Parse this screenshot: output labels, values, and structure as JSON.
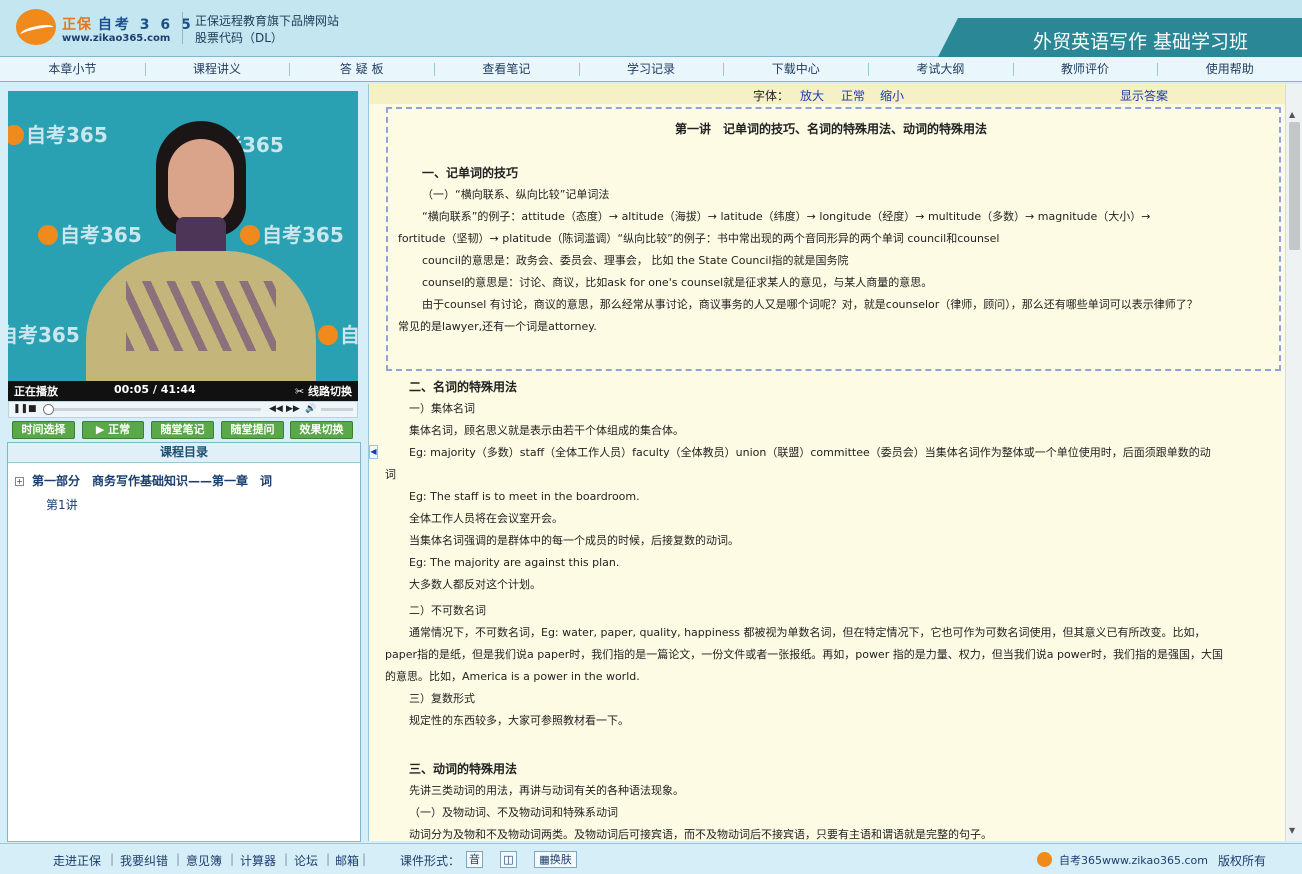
{
  "header": {
    "brand_cn": "正保",
    "brand_kao": "自考 3 6 5",
    "url": "www.zikao365.com",
    "tagline": "正保远程教育旗下品牌网站",
    "stock": "股票代码（DL）",
    "course_title": "外贸英语写作 基础学习班"
  },
  "nav": [
    "本章小节",
    "课程讲义",
    "答 疑 板",
    "查看笔记",
    "学习记录",
    "下载中心",
    "考试大纲",
    "教师评价",
    "使用帮助"
  ],
  "video": {
    "watermark": "自考365",
    "watermark_url": "zikao365.com",
    "status": "正在播放",
    "time": "00:05 / 41:44",
    "switch_line": "线路切换",
    "progress": 0.0
  },
  "buttons": {
    "time_select": "时间选择",
    "normal": "▶ 正常",
    "notes": "随堂笔记",
    "ask": "随堂提问",
    "effect": "效果切换"
  },
  "catalog": {
    "header": "课程目录",
    "part": "第一部分　商务写作基础知识——第一章　词",
    "lesson": "第1讲"
  },
  "font_bar": {
    "label": "字体：",
    "enlarge": "放大",
    "normal": "正常",
    "shrink": "缩小",
    "show_answer": "显示答案"
  },
  "lecture": {
    "title": "第一讲　记单词的技巧、名词的特殊用法、动词的特殊用法",
    "s1_heading": "一、记单词的技巧",
    "s1_sub": "（一）“横向联系、纵向比较”记单词法",
    "s1_p1_l1": "“横向联系”的例子：attitude（态度）→ altitude（海拔）→ latitude（纬度）→ longitude（经度）→ multitude（多数）→ magnitude（大小）→",
    "s1_p1_l2": "fortitude（坚韧）→ platitude（陈词滥调）“纵向比较”的例子：书中常出现的两个音同形异的两个单词 council和counsel",
    "s1_p2": "council的意思是：政务会、委员会、理事会， 比如 the State Council指的就是国务院",
    "s1_p3": "counsel的意思是：讨论、商议，比如ask for one's counsel就是征求某人的意见，与某人商量的意思。",
    "s1_p4_l1": "由于counsel 有讨论，商议的意思，那么经常从事讨论，商议事务的人又是哪个词呢？对，就是counselor（律师，顾问），那么还有哪些单词可以表示律师了？",
    "s1_p4_l2": "常见的是lawyer,还有一个词是attorney.",
    "s2_heading": "二、名词的特殊用法",
    "s2_sub1": "一）集体名词",
    "s2_p1": "集体名词，顾名思义就是表示由若干个体组成的集合体。",
    "s2_p2_l1": "Eg: majority（多数）staff（全体工作人员）faculty（全体教员）union（联盟）committee（委员会）当集体名词作为整体或一个单位使用时，后面须跟单数的动",
    "s2_p2_l2": "词",
    "s2_p3": "Eg: The staff is to meet in the boardroom.",
    "s2_p4": "全体工作人员将在会议室开会。",
    "s2_p5": "当集体名词强调的是群体中的每一个成员的时候，后接复数的动词。",
    "s2_p6": "Eg: The majority are against this plan.",
    "s2_p7": "大多数人都反对这个计划。",
    "s2_sub2": "二）不可数名词",
    "s2_p8_l1": "通常情况下，不可数名词，Eg: water, paper, quality, happiness 都被视为单数名词，但在特定情况下，它也可作为可数名词使用，但其意义已有所改变。比如，",
    "s2_p8_l2": "paper指的是纸，但是我们说a paper时，我们指的是一篇论文，一份文件或者一张报纸。再如，power 指的是力量、权力，但当我们说a power时，我们指的是强国，大国",
    "s2_p8_l3": "的意思。比如，America is a power in the world.",
    "s2_sub3": "三）复数形式",
    "s2_p9": "规定性的东西较多，大家可参照教材看一下。",
    "s3_heading": "三、动词的特殊用法",
    "s3_p1": "先讲三类动词的用法，再讲与动词有关的各种语法现象。",
    "s3_sub1": "（一）及物动词、不及物动词和特殊系动词",
    "s3_p2": "动词分为及物和不及物动词两类。及物动词后可接宾语，而不及物动词后不接宾语，只要有主语和谓语就是完整的句子。"
  },
  "footer": {
    "links": [
      "走进正保",
      "我要纠错",
      "意见簿",
      "计算器",
      "论坛",
      "邮箱"
    ],
    "format_label": "课件形式：",
    "format_btn1": "音",
    "format_btn2": "",
    "skin_btn": "换肤",
    "site": "自考365www.zikao365.com",
    "copyright": "版权所有"
  },
  "colors": {
    "header_bg": "#c3e6f1",
    "banner": "#2a8896",
    "content_bg": "#fdfbe3",
    "link": "#1d3bb0",
    "button_green": "#5aa84a",
    "brand_orange": "#f08a1c"
  }
}
